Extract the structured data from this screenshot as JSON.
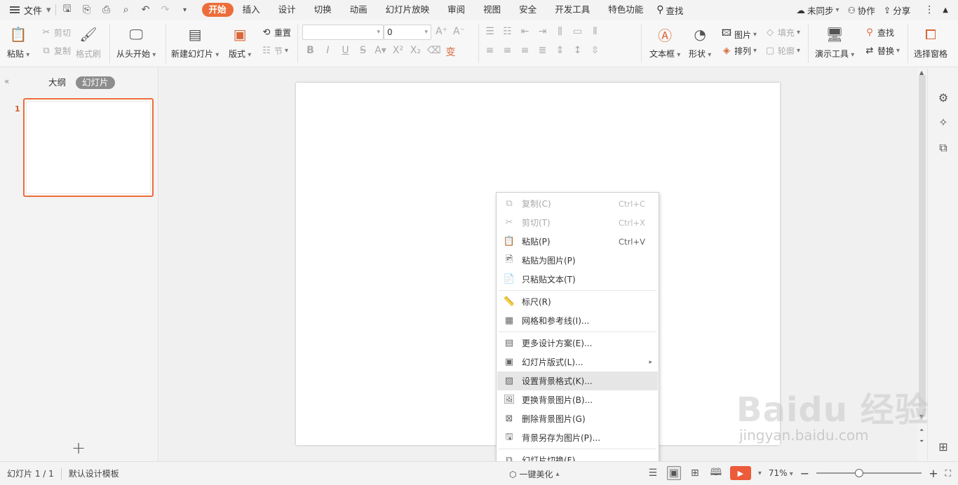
{
  "menubar": {
    "file_label": "文件",
    "tabs": [
      "开始",
      "插入",
      "设计",
      "切换",
      "动画",
      "幻灯片放映",
      "审阅",
      "视图",
      "安全",
      "开发工具",
      "特色功能"
    ],
    "search_label": "查找",
    "sync_label": "未同步",
    "collab_label": "协作",
    "share_label": "分享"
  },
  "ribbon": {
    "paste": "粘贴",
    "cut": "剪切",
    "copy": "复制",
    "format_painter": "格式刷",
    "from_start": "从头开始",
    "new_slide": "新建幻灯片",
    "layout": "版式",
    "reset": "重置",
    "section": "节",
    "font_size": "0",
    "textbox": "文本框",
    "shape": "形状",
    "picture": "图片",
    "arrange": "排列",
    "fill": "填充",
    "outline": "轮廓",
    "present_tools": "演示工具",
    "find": "查找",
    "replace": "替换",
    "select_pane": "选择窗格"
  },
  "leftpanel": {
    "outline_tab": "大纲",
    "slides_tab": "幻灯片",
    "slide_number": "1"
  },
  "context_menu": {
    "items": [
      {
        "label": "复制(C)",
        "shortcut": "Ctrl+C"
      },
      {
        "label": "剪切(T)",
        "shortcut": "Ctrl+X"
      },
      {
        "label": "粘贴(P)",
        "shortcut": "Ctrl+V"
      },
      {
        "label": "粘贴为图片(P)"
      },
      {
        "label": "只粘贴文本(T)"
      },
      {
        "label": "标尺(R)"
      },
      {
        "label": "网格和参考线(I)..."
      },
      {
        "label": "更多设计方案(E)..."
      },
      {
        "label": "幻灯片版式(L)..."
      },
      {
        "label": "设置背景格式(K)..."
      },
      {
        "label": "更换背景图片(B)..."
      },
      {
        "label": "删除背景图片(G)"
      },
      {
        "label": "背景另存为图片(P)..."
      },
      {
        "label": "幻灯片切换(F)..."
      }
    ]
  },
  "statusbar": {
    "slide_info": "幻灯片 1 / 1",
    "template": "默认设计模板",
    "beautify": "一键美化",
    "zoom": "71%",
    "zoom_level": 0.4
  },
  "watermark": {
    "brand": "Baidu 经验",
    "url": "jingyan.baidu.com"
  },
  "colors": {
    "accent": "#ec6d3a",
    "play": "#ec5b3a"
  }
}
